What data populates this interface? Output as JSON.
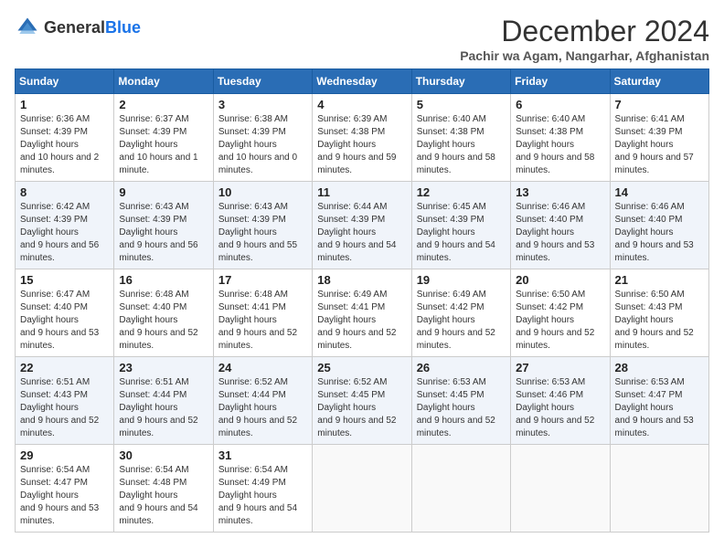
{
  "header": {
    "logo_general": "General",
    "logo_blue": "Blue",
    "title": "December 2024",
    "location": "Pachir wa Agam, Nangarhar, Afghanistan"
  },
  "weekdays": [
    "Sunday",
    "Monday",
    "Tuesday",
    "Wednesday",
    "Thursday",
    "Friday",
    "Saturday"
  ],
  "weeks": [
    [
      {
        "day": "1",
        "sunrise": "6:36 AM",
        "sunset": "4:39 PM",
        "daylight": "10 hours and 2 minutes."
      },
      {
        "day": "2",
        "sunrise": "6:37 AM",
        "sunset": "4:39 PM",
        "daylight": "10 hours and 1 minute."
      },
      {
        "day": "3",
        "sunrise": "6:38 AM",
        "sunset": "4:39 PM",
        "daylight": "10 hours and 0 minutes."
      },
      {
        "day": "4",
        "sunrise": "6:39 AM",
        "sunset": "4:38 PM",
        "daylight": "9 hours and 59 minutes."
      },
      {
        "day": "5",
        "sunrise": "6:40 AM",
        "sunset": "4:38 PM",
        "daylight": "9 hours and 58 minutes."
      },
      {
        "day": "6",
        "sunrise": "6:40 AM",
        "sunset": "4:38 PM",
        "daylight": "9 hours and 58 minutes."
      },
      {
        "day": "7",
        "sunrise": "6:41 AM",
        "sunset": "4:39 PM",
        "daylight": "9 hours and 57 minutes."
      }
    ],
    [
      {
        "day": "8",
        "sunrise": "6:42 AM",
        "sunset": "4:39 PM",
        "daylight": "9 hours and 56 minutes."
      },
      {
        "day": "9",
        "sunrise": "6:43 AM",
        "sunset": "4:39 PM",
        "daylight": "9 hours and 56 minutes."
      },
      {
        "day": "10",
        "sunrise": "6:43 AM",
        "sunset": "4:39 PM",
        "daylight": "9 hours and 55 minutes."
      },
      {
        "day": "11",
        "sunrise": "6:44 AM",
        "sunset": "4:39 PM",
        "daylight": "9 hours and 54 minutes."
      },
      {
        "day": "12",
        "sunrise": "6:45 AM",
        "sunset": "4:39 PM",
        "daylight": "9 hours and 54 minutes."
      },
      {
        "day": "13",
        "sunrise": "6:46 AM",
        "sunset": "4:40 PM",
        "daylight": "9 hours and 53 minutes."
      },
      {
        "day": "14",
        "sunrise": "6:46 AM",
        "sunset": "4:40 PM",
        "daylight": "9 hours and 53 minutes."
      }
    ],
    [
      {
        "day": "15",
        "sunrise": "6:47 AM",
        "sunset": "4:40 PM",
        "daylight": "9 hours and 53 minutes."
      },
      {
        "day": "16",
        "sunrise": "6:48 AM",
        "sunset": "4:40 PM",
        "daylight": "9 hours and 52 minutes."
      },
      {
        "day": "17",
        "sunrise": "6:48 AM",
        "sunset": "4:41 PM",
        "daylight": "9 hours and 52 minutes."
      },
      {
        "day": "18",
        "sunrise": "6:49 AM",
        "sunset": "4:41 PM",
        "daylight": "9 hours and 52 minutes."
      },
      {
        "day": "19",
        "sunrise": "6:49 AM",
        "sunset": "4:42 PM",
        "daylight": "9 hours and 52 minutes."
      },
      {
        "day": "20",
        "sunrise": "6:50 AM",
        "sunset": "4:42 PM",
        "daylight": "9 hours and 52 minutes."
      },
      {
        "day": "21",
        "sunrise": "6:50 AM",
        "sunset": "4:43 PM",
        "daylight": "9 hours and 52 minutes."
      }
    ],
    [
      {
        "day": "22",
        "sunrise": "6:51 AM",
        "sunset": "4:43 PM",
        "daylight": "9 hours and 52 minutes."
      },
      {
        "day": "23",
        "sunrise": "6:51 AM",
        "sunset": "4:44 PM",
        "daylight": "9 hours and 52 minutes."
      },
      {
        "day": "24",
        "sunrise": "6:52 AM",
        "sunset": "4:44 PM",
        "daylight": "9 hours and 52 minutes."
      },
      {
        "day": "25",
        "sunrise": "6:52 AM",
        "sunset": "4:45 PM",
        "daylight": "9 hours and 52 minutes."
      },
      {
        "day": "26",
        "sunrise": "6:53 AM",
        "sunset": "4:45 PM",
        "daylight": "9 hours and 52 minutes."
      },
      {
        "day": "27",
        "sunrise": "6:53 AM",
        "sunset": "4:46 PM",
        "daylight": "9 hours and 52 minutes."
      },
      {
        "day": "28",
        "sunrise": "6:53 AM",
        "sunset": "4:47 PM",
        "daylight": "9 hours and 53 minutes."
      }
    ],
    [
      {
        "day": "29",
        "sunrise": "6:54 AM",
        "sunset": "4:47 PM",
        "daylight": "9 hours and 53 minutes."
      },
      {
        "day": "30",
        "sunrise": "6:54 AM",
        "sunset": "4:48 PM",
        "daylight": "9 hours and 54 minutes."
      },
      {
        "day": "31",
        "sunrise": "6:54 AM",
        "sunset": "4:49 PM",
        "daylight": "9 hours and 54 minutes."
      },
      null,
      null,
      null,
      null
    ]
  ],
  "labels": {
    "sunrise": "Sunrise:",
    "sunset": "Sunset:",
    "daylight": "Daylight hours"
  }
}
